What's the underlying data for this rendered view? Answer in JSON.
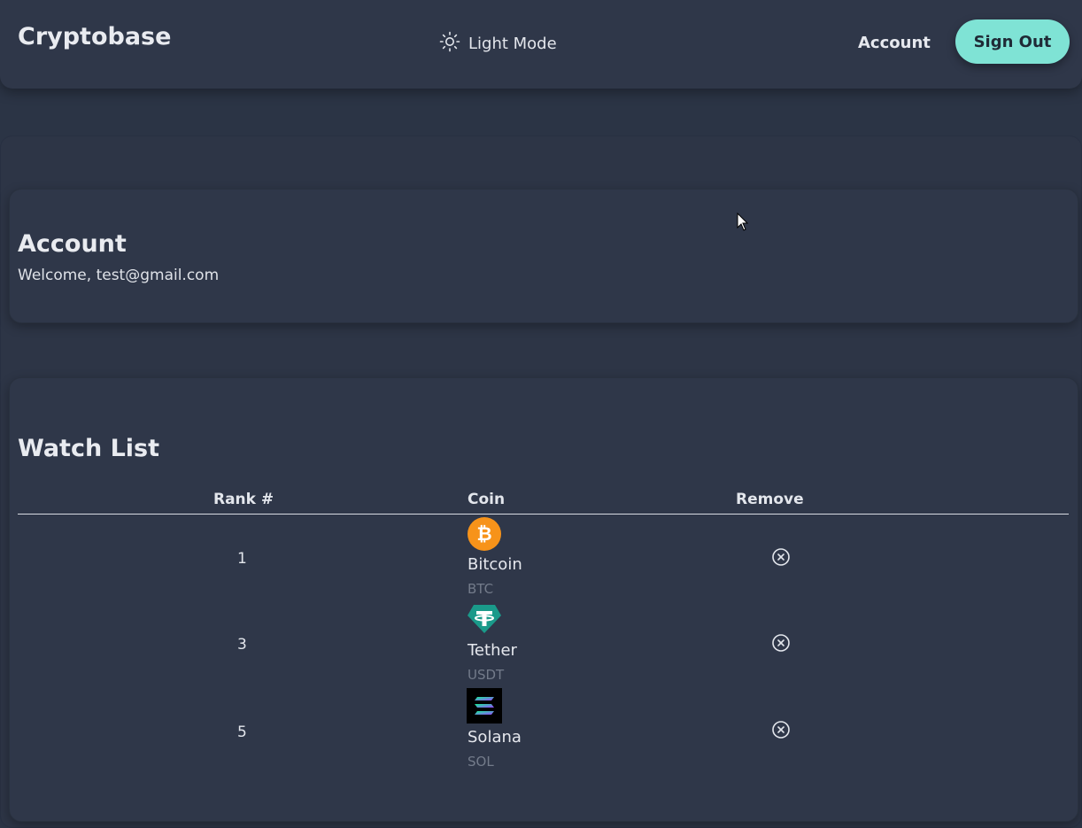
{
  "header": {
    "brand": "Cryptobase",
    "theme_toggle_label": "Light Mode",
    "theme_icon": "sun-icon",
    "nav_account": "Account",
    "sign_out": "Sign Out"
  },
  "account": {
    "title": "Account",
    "welcome": "Welcome, test@gmail.com"
  },
  "watchlist": {
    "title": "Watch List",
    "columns": [
      "Rank #",
      "Coin",
      "Remove"
    ],
    "rows": [
      {
        "rank": "1",
        "name": "Bitcoin",
        "symbol": "BTC",
        "icon": "bitcoin-icon",
        "color": "#f7931a"
      },
      {
        "rank": "3",
        "name": "Tether",
        "symbol": "USDT",
        "icon": "tether-icon",
        "color": "#1a9a8a"
      },
      {
        "rank": "5",
        "name": "Solana",
        "symbol": "SOL",
        "icon": "solana-icon",
        "color": "#000000"
      }
    ],
    "remove_icon": "close-circle-icon"
  },
  "colors": {
    "background": "#2b3445",
    "card": "#2f3749",
    "accent": "#7fe3d5"
  }
}
